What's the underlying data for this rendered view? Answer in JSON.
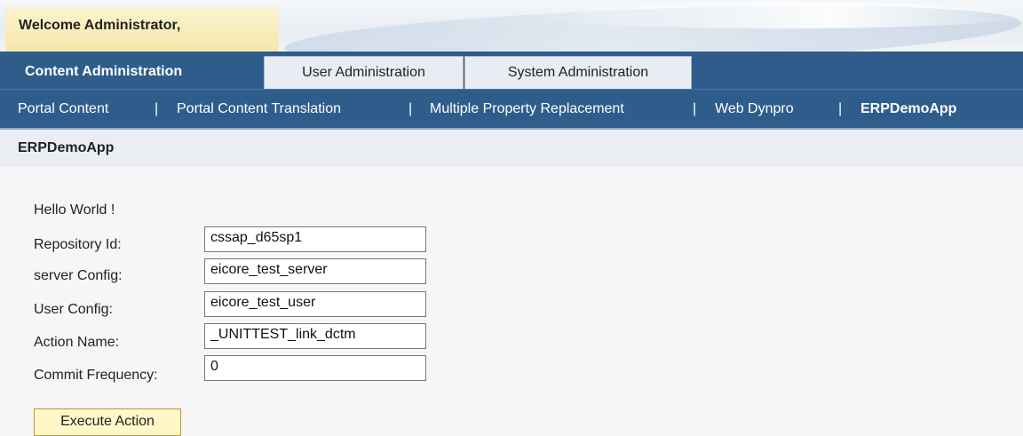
{
  "header": {
    "welcome": "Welcome Administrator,"
  },
  "tabs": [
    {
      "label": "Content Administration",
      "active": true
    },
    {
      "label": "User Administration",
      "active": false
    },
    {
      "label": "System Administration",
      "active": false
    }
  ],
  "subnav": {
    "items": [
      "Portal Content",
      "Portal Content Translation",
      "Multiple Property Replacement",
      "Web Dynpro",
      "ERPDemoApp"
    ],
    "separator": "|",
    "current": "ERPDemoApp"
  },
  "page": {
    "title": "ERPDemoApp",
    "hello": "Hello World !",
    "fields": [
      {
        "label": "Repository Id:",
        "value": "cssap_d65sp1"
      },
      {
        "label": "server Config:",
        "value": "eicore_test_server"
      },
      {
        "label": "User Config:",
        "value": "eicore_test_user"
      },
      {
        "label": "Action Name:",
        "value": "_UNITTEST_link_dctm"
      },
      {
        "label": "Commit Frequency:",
        "value": "0"
      }
    ],
    "execute_label": "Execute Action"
  },
  "colors": {
    "nav_blue": "#2f5d8b",
    "welcome_bg": "#f6e7a9",
    "button_bg": "#fff7c8"
  }
}
